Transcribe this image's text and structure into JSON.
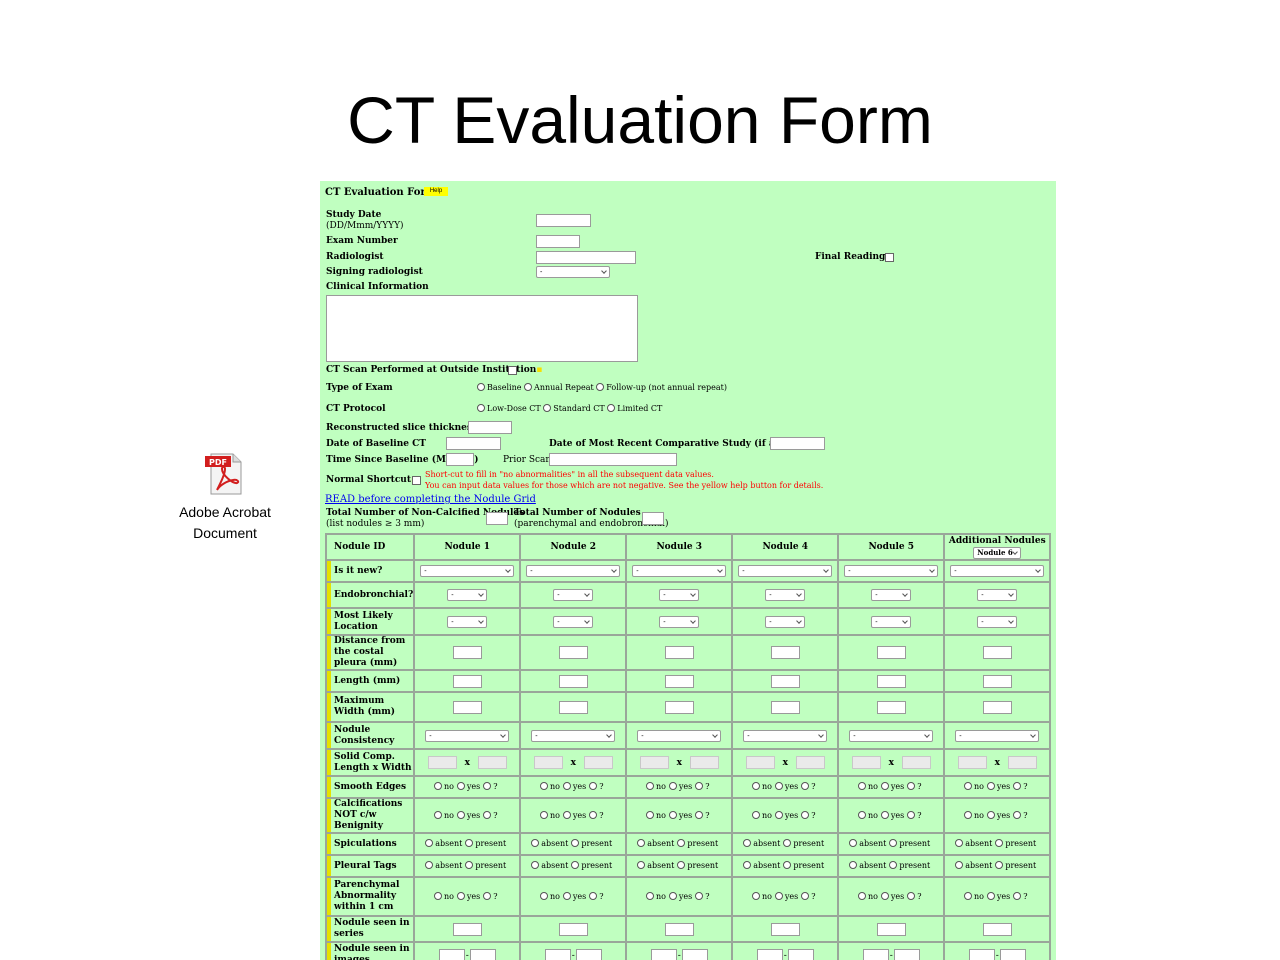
{
  "slide": {
    "title": "CT Evaluation Form",
    "attachment": {
      "icon": "pdf-file-icon",
      "line1": "Adobe Acrobat",
      "line2": "Document"
    }
  },
  "form": {
    "title": "CT Evaluation Form",
    "help_label": "Help",
    "study_date_label": "Study Date",
    "study_date_format": "(DD/Mmm/YYYY)",
    "exam_number_label": "Exam Number",
    "radiologist_label": "Radiologist",
    "final_reading_label": "Final Reading",
    "signing_radiologist_label": "Signing radiologist",
    "signing_radiologist_value": "-",
    "clinical_info_label": "Clinical Information",
    "outside_institution_label": "CT Scan Performed at Outside Institution",
    "type_of_exam_label": "Type of Exam",
    "type_of_exam_options": [
      "Baseline",
      "Annual Repeat",
      "Follow-up (not annual repeat)"
    ],
    "ct_protocol_label": "CT Protocol",
    "ct_protocol_options": [
      "Low-Dose CT",
      "Standard CT",
      "Limited CT"
    ],
    "slice_thickness_label": "Reconstructed slice thickness (mm)",
    "date_baseline_label": "Date of Baseline CT",
    "date_recent_label": "Date of Most Recent Comparative Study (if applicable)",
    "time_since_label": "Time Since Baseline (Months)",
    "prior_scans_label": "Prior Scans",
    "normal_shortcut_label": "Normal Shortcut",
    "shortcut_note_1": "Short-cut to fill in \"no abnormalities\" in all the subsequent data values.",
    "shortcut_note_2": "You can input data values for those which are not negative. See the yellow help button for details.",
    "read_link": "READ before completing the Nodule Grid",
    "total_noncalc_label": "Total Number of Non-Calcified Nodules",
    "total_noncalc_sub": "(list nodules ≥ 3 mm)",
    "total_nodules_label": "Total Number of Nodules",
    "total_nodules_sub": "(parenchymal and endobronchial)"
  },
  "grid": {
    "id_label": "Nodule ID",
    "columns": [
      "Nodule 1",
      "Nodule 2",
      "Nodule 3",
      "Nodule 4",
      "Nodule 5"
    ],
    "additional_label": "Additional Nodules",
    "additional_value": "Nodule 6",
    "dash": "-",
    "x_sep": "x",
    "yes_no": [
      "no",
      "yes",
      "?"
    ],
    "absent_present": [
      "absent",
      "present"
    ],
    "rows": [
      {
        "label": "Is it new?",
        "type": "select-wide"
      },
      {
        "label": "Endobronchial?",
        "type": "select-small"
      },
      {
        "label": "Most Likely Location",
        "type": "select-small"
      },
      {
        "label": "Distance from the costal pleura (mm)",
        "type": "input"
      },
      {
        "label": "Length (mm)",
        "type": "input"
      },
      {
        "label": "Maximum Width (mm)",
        "type": "input"
      },
      {
        "label": "Nodule Consistency",
        "type": "select-medium"
      },
      {
        "label": "Solid Comp. Length x Width",
        "type": "lxw"
      },
      {
        "label": "Smooth Edges",
        "type": "ynq"
      },
      {
        "label": "Calcifications NOT c/w Benignity",
        "type": "ynq"
      },
      {
        "label": "Spiculations",
        "type": "ap"
      },
      {
        "label": "Pleural Tags",
        "type": "ap"
      },
      {
        "label": "Parenchymal Abnormality within 1 cm",
        "type": "ynq"
      },
      {
        "label": "Nodule seen in series",
        "type": "input"
      },
      {
        "label": "Nodule seen in images",
        "type": "range"
      }
    ]
  }
}
